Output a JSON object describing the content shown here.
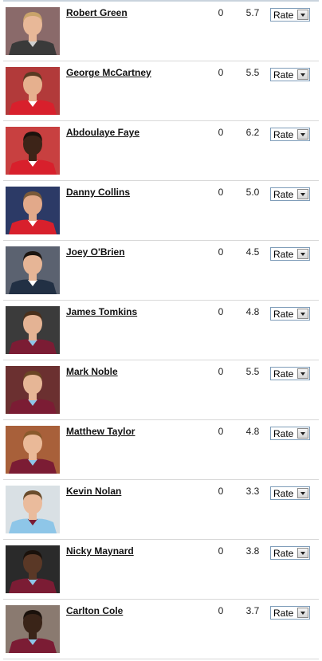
{
  "players": [
    {
      "name": "Robert Green",
      "votes": "0",
      "score": "5.7",
      "rate_label": "Rate",
      "kit": "#3a3a3a",
      "trim": "#cfcfcf",
      "bg": "#8a6a6a",
      "skin": "#e8b898",
      "hair": "#c9a36a"
    },
    {
      "name": "George McCartney",
      "votes": "0",
      "score": "5.5",
      "rate_label": "Rate",
      "kit": "#d8202c",
      "trim": "#ffffff",
      "bg": "#b23a3a",
      "skin": "#e6b08e",
      "hair": "#5a3a22"
    },
    {
      "name": "Abdoulaye Faye",
      "votes": "0",
      "score": "6.2",
      "rate_label": "Rate",
      "kit": "#d8202c",
      "trim": "#ffffff",
      "bg": "#c84040",
      "skin": "#3d2418",
      "hair": "#1b120c"
    },
    {
      "name": "Danny Collins",
      "votes": "0",
      "score": "5.0",
      "rate_label": "Rate",
      "kit": "#d8202c",
      "trim": "#ffffff",
      "bg": "#2c3a66",
      "skin": "#e2a98a",
      "hair": "#7a5a3a"
    },
    {
      "name": "Joey O'Brien",
      "votes": "0",
      "score": "4.5",
      "rate_label": "Rate",
      "kit": "#223044",
      "trim": "#ffffff",
      "bg": "#5b6270",
      "skin": "#e6b596",
      "hair": "#1c1510"
    },
    {
      "name": "James Tomkins",
      "votes": "0",
      "score": "4.8",
      "rate_label": "Rate",
      "kit": "#7b1c34",
      "trim": "#8ec6e8",
      "bg": "#3b3b3b",
      "skin": "#e4b394",
      "hair": "#4a301c"
    },
    {
      "name": "Mark Noble",
      "votes": "0",
      "score": "5.5",
      "rate_label": "Rate",
      "kit": "#7b1c34",
      "trim": "#8ec6e8",
      "bg": "#6b3030",
      "skin": "#e6b696",
      "hair": "#6a4524"
    },
    {
      "name": "Matthew Taylor",
      "votes": "0",
      "score": "4.8",
      "rate_label": "Rate",
      "kit": "#7b1c34",
      "trim": "#8ec6e8",
      "bg": "#a8603a",
      "skin": "#eab998",
      "hair": "#8a5a2c"
    },
    {
      "name": "Kevin Nolan",
      "votes": "0",
      "score": "3.3",
      "rate_label": "Rate",
      "kit": "#8ec6e8",
      "trim": "#7b1c34",
      "bg": "#d9e0e4",
      "skin": "#eabb9c",
      "hair": "#6a4c2c"
    },
    {
      "name": "Nicky Maynard",
      "votes": "0",
      "score": "3.8",
      "rate_label": "Rate",
      "kit": "#7b1c34",
      "trim": "#8ec6e8",
      "bg": "#2a2a2a",
      "skin": "#5a3826",
      "hair": "#1a110b"
    },
    {
      "name": "Carlton Cole",
      "votes": "0",
      "score": "3.7",
      "rate_label": "Rate",
      "kit": "#7b1c34",
      "trim": "#8ec6e8",
      "bg": "#8a7a70",
      "skin": "#3a2418",
      "hair": "#1a110b"
    }
  ]
}
